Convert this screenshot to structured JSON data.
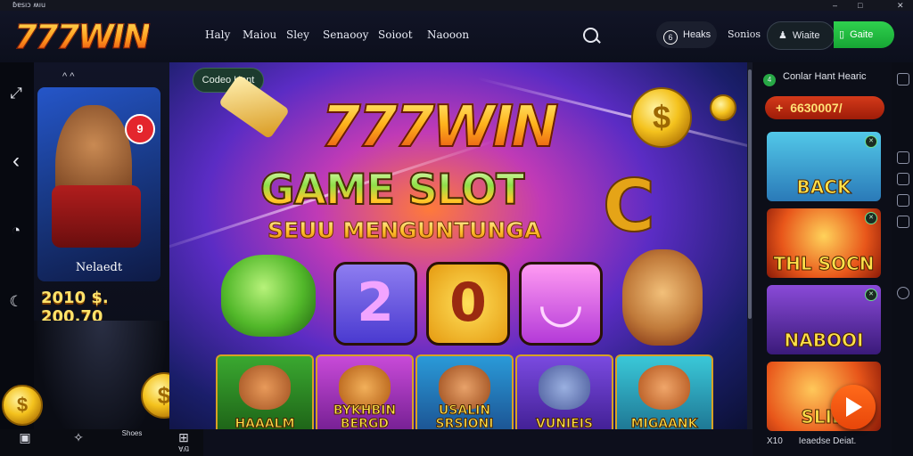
{
  "window": {
    "title": "ɓɐsıɔ ʍıu",
    "controls": [
      "–",
      "□",
      "✕"
    ]
  },
  "header": {
    "logo": "777WIN",
    "nav": [
      "Haly",
      "Maiou",
      "Sley",
      "Senaooy",
      "Soioot",
      "Naooon"
    ],
    "mode_icon": "6",
    "mode_label": "Heaks",
    "signup": "Sonios",
    "login": "Wiaite",
    "register": "Gaite"
  },
  "leftcol": {
    "arrows": "^ ^",
    "promo_badge": "9",
    "promo_label": "Nelaedt",
    "jackpot": "2010 $. 200.70"
  },
  "bottombar": [
    {
      "icon": "▣",
      "label": ""
    },
    {
      "icon": "✧",
      "label": ""
    },
    {
      "icon": "",
      "label": "Shoes"
    },
    {
      "icon": "⊞",
      "label": "Ɐʎʇ"
    }
  ],
  "hero": {
    "tag": "Codeo Hent",
    "title": "777WIN",
    "subtitle": "GAME SLOT",
    "subtitle_letter": "C",
    "tagline": "SEUU MENGUNTUNGA",
    "tiles": [
      "2",
      "0",
      "◡"
    ],
    "games": [
      {
        "name": "HAAALM"
      },
      {
        "name": "BYKHBIN BERGD"
      },
      {
        "name": "USALIN SRSIONI"
      },
      {
        "name": "VUNIEIS"
      },
      {
        "name": "MIGAANK"
      }
    ]
  },
  "rightcol": {
    "header": "Conlar Hant Hearic",
    "header_icon": "4",
    "balance_plus": "+",
    "balance": "6630007/",
    "cards": [
      {
        "name": "BACK"
      },
      {
        "name": "THL SOCN"
      },
      {
        "name": "NABOOI"
      },
      {
        "name": "SLID"
      }
    ],
    "footer_left": "X10",
    "footer_right": "Ieaedse Deiat."
  },
  "colors": {
    "accent_green": "#27a845",
    "accent_orange": "#ff6a1a",
    "gold": "#ffe14a"
  }
}
